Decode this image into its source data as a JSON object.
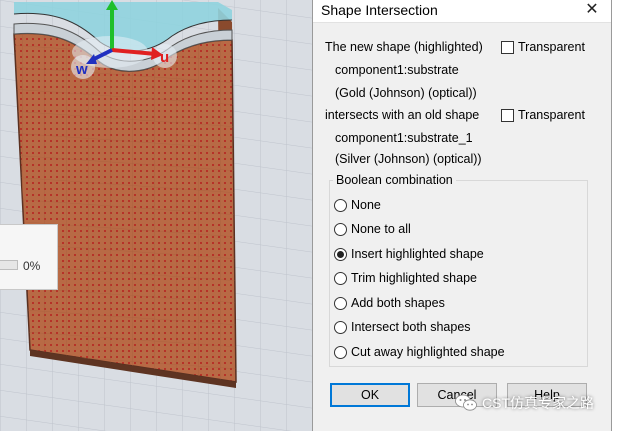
{
  "viewport": {
    "axes": {
      "w_label": "w",
      "u_label": "u"
    },
    "colors": {
      "substrate": "#b86a45",
      "dot": "#b51f1f",
      "film": "#8fd3de",
      "background": "#d9dde3"
    }
  },
  "progress": {
    "text": "0%",
    "fraction": 0.0
  },
  "dialog": {
    "title": "Shape Intersection",
    "new_shape_label": "The new shape (highlighted)",
    "transparent_label": "Transparent",
    "new_shape_name": "component1:substrate",
    "new_shape_material": "(Gold (Johnson) (optical))",
    "intersects_label": "intersects with an old shape",
    "old_shape_name": "component1:substrate_1",
    "old_shape_material": "(Silver (Johnson) (optical))",
    "boolean_title": "Boolean combination",
    "options": [
      {
        "label": "None",
        "checked": false
      },
      {
        "label": "None to all",
        "checked": false
      },
      {
        "label": "Insert highlighted shape",
        "checked": true
      },
      {
        "label": "Trim highlighted shape",
        "checked": false
      },
      {
        "label": "Add both shapes",
        "checked": false
      },
      {
        "label": "Intersect both shapes",
        "checked": false
      },
      {
        "label": "Cut away highlighted shape",
        "checked": false
      }
    ],
    "buttons": {
      "ok": "OK",
      "cancel": "Cancel",
      "help": "Help"
    }
  },
  "watermark": {
    "text": "CST仿真专家之路"
  }
}
